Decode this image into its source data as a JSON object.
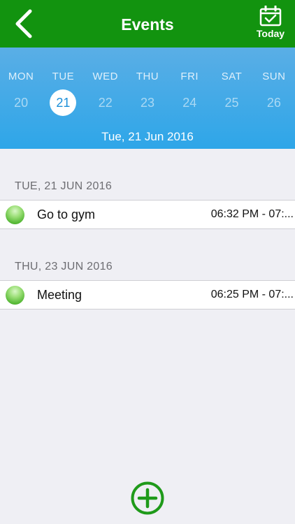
{
  "header": {
    "title": "Events",
    "today_label": "Today"
  },
  "week": {
    "days": [
      {
        "name": "MON",
        "num": "20"
      },
      {
        "name": "TUE",
        "num": "21"
      },
      {
        "name": "WED",
        "num": "22"
      },
      {
        "name": "THU",
        "num": "23"
      },
      {
        "name": "FRI",
        "num": "24"
      },
      {
        "name": "SAT",
        "num": "25"
      },
      {
        "name": "SUN",
        "num": "26"
      }
    ],
    "selected_date": "Tue, 21 Jun 2016"
  },
  "sections": [
    {
      "header": "TUE, 21 JUN 2016",
      "events": [
        {
          "title": "Go to gym",
          "time": "06:32 PM - 07:..."
        }
      ]
    },
    {
      "header": "THU, 23 JUN 2016",
      "events": [
        {
          "title": "Meeting",
          "time": "06:25 PM - 07:..."
        }
      ]
    }
  ],
  "colors": {
    "nav_bar": "#12930f",
    "week_bar": "#2ea6e8",
    "selected_day": "#1b8fd9",
    "event_dot": "#55b835",
    "add_button": "#1f9a1a"
  }
}
